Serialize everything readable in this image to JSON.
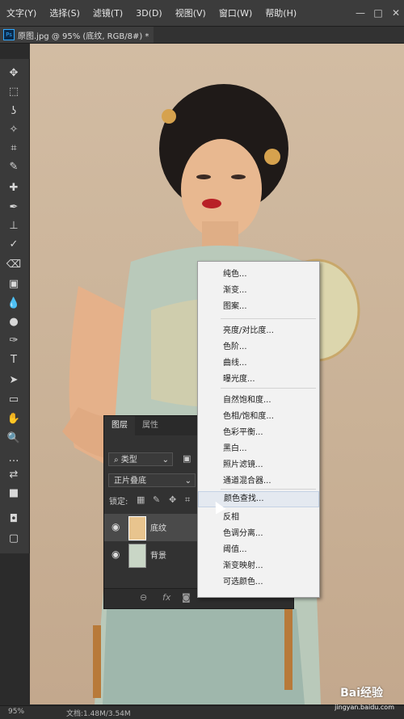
{
  "menubar": {
    "items": [
      "文字(Y)",
      "选择(S)",
      "滤镜(T)",
      "3D(D)",
      "视图(V)",
      "窗口(W)",
      "帮助(H)"
    ]
  },
  "window_controls": [
    "—",
    "□",
    "✕"
  ],
  "document_tab": {
    "title": "原图.jpg @ 95% (底纹, RGB/8#) *"
  },
  "tools": [
    "move-icon",
    "marquee-icon",
    "lasso-icon",
    "magic-wand-icon",
    "crop-icon",
    "eyedropper-icon",
    "healing-icon",
    "brush-icon",
    "stamp-icon",
    "history-brush-icon",
    "eraser-icon",
    "gradient-icon",
    "blur-icon",
    "dodge-icon",
    "pen-icon",
    "type-icon",
    "path-select-icon",
    "rectangle-icon",
    "hand-icon",
    "zoom-icon",
    "more-icon",
    "swap-colors-icon",
    "color-swatch-icon",
    "quick-mask-icon",
    "screen-mode-icon"
  ],
  "tool_glyphs": [
    "✥",
    "⬚",
    "ʖ",
    "✧",
    "⌗",
    "✎",
    "✚",
    "✒",
    "⊥",
    "✓",
    "⌫",
    "▣",
    "💧",
    "●",
    "✑",
    "T",
    "➤",
    "▭",
    "✋",
    "🔍",
    "…",
    "⇄",
    "■",
    "◘",
    "▢"
  ],
  "status": {
    "zoom": "95%",
    "doc_size": "文档:1.48M/3.54M"
  },
  "layers_panel": {
    "tabs": [
      "图层",
      "属性"
    ],
    "filter_label": "类型",
    "blend_mode": "正片叠底",
    "lock_label": "锁定:",
    "layers": [
      {
        "name": "底纹",
        "selected": true,
        "thumb_color": "#e8c48e"
      },
      {
        "name": "背景",
        "selected": false,
        "thumb_color": "#c9d6c6"
      }
    ],
    "bottom_icons": [
      "⊖",
      "fx",
      "◙"
    ]
  },
  "context_menu": {
    "items": [
      "纯色...",
      "渐变...",
      "图案...",
      "亮度/对比度...",
      "色阶...",
      "曲线...",
      "曝光度...",
      "自然饱和度...",
      "色相/饱和度...",
      "色彩平衡...",
      "黑白...",
      "照片滤镜...",
      "通道混合器...",
      "颜色查找...",
      "反相",
      "色调分离...",
      "阈值...",
      "渐变映射...",
      "可选颜色..."
    ],
    "hovered": "颜色查找..."
  },
  "watermark": {
    "brand": "Bai经验",
    "url": "jingyan.baidu.com"
  },
  "colors": {
    "accent": "#31a8ff",
    "menu_bg": "#f2f2f2",
    "panel_bg": "#323232"
  }
}
